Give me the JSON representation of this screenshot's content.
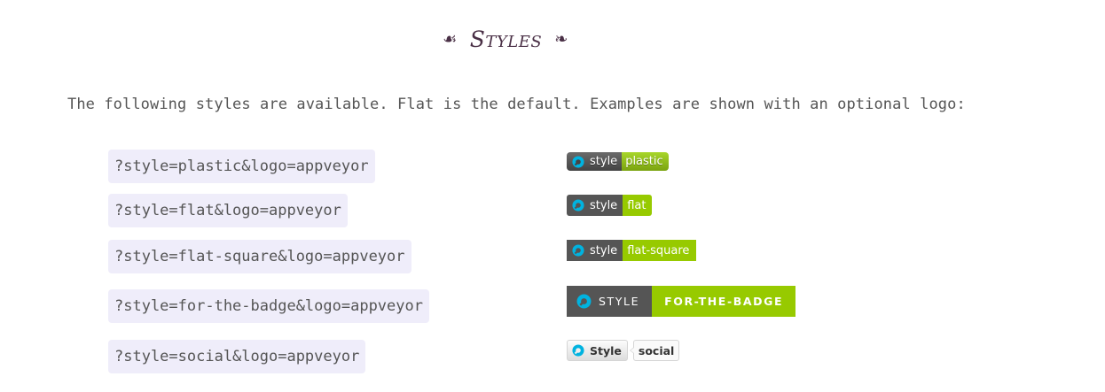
{
  "heading": {
    "title": "Styles",
    "ornament_left": "☙",
    "ornament_right": "❧"
  },
  "intro": "The following styles are available. Flat is the default. Examples are shown with an optional logo:",
  "colors": {
    "badge_label_bg": "#555555",
    "badge_message_bg": "#97ca00",
    "code_bg": "#efedfa",
    "heading": "#4a3046",
    "logo": "#00b3e0"
  },
  "styles": [
    {
      "query": "?style=plastic&logo=appveyor",
      "label": "style",
      "message": "plastic",
      "logo_icon": "appveyor-icon"
    },
    {
      "query": "?style=flat&logo=appveyor",
      "label": "style",
      "message": "flat",
      "logo_icon": "appveyor-icon"
    },
    {
      "query": "?style=flat-square&logo=appveyor",
      "label": "style",
      "message": "flat-square",
      "logo_icon": "appveyor-icon"
    },
    {
      "query": "?style=for-the-badge&logo=appveyor",
      "label": "STYLE",
      "message": "FOR-THE-BADGE",
      "logo_icon": "appveyor-icon"
    },
    {
      "query": "?style=social&logo=appveyor",
      "label": "Style",
      "message": "social",
      "logo_icon": "appveyor-icon"
    }
  ]
}
